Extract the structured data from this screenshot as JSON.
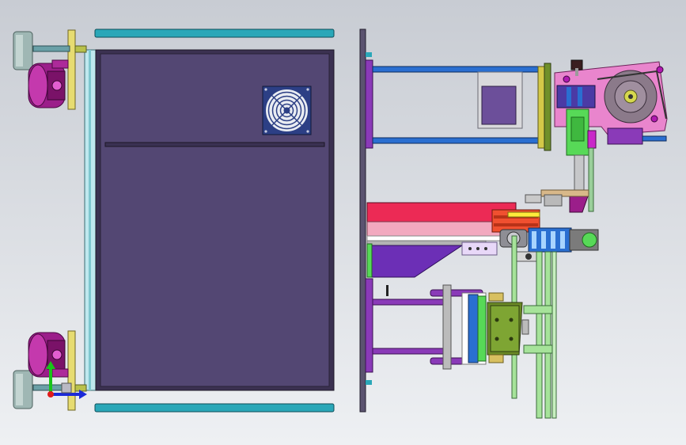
{
  "viewport": {
    "background_top": "#c8ccd3",
    "background_bottom": "#eef0f3"
  },
  "colors": {
    "cabinet_panel": "#534773",
    "cabinet_frame": "#3b3151",
    "rail": "#2aa7b8",
    "glass_edge": "#bfe8ee",
    "plate_yellow": "#e7dc71",
    "caster_magenta": "#9b1e8a",
    "foot_grey": "#7e9a96",
    "frame_blue": "#2a6fd1",
    "arm_purple": "#8a3ab8",
    "bracket_pink": "#e985cd",
    "red_block": "#ec2a55",
    "green_block": "#57d957",
    "olive_block": "#6b8a26",
    "light_green": "#a6e39a",
    "fan_blue": "#2c3f85"
  },
  "icons": {
    "fan": "fan-grille-icon",
    "axis_triad": "xyz-axis-triad-icon"
  }
}
